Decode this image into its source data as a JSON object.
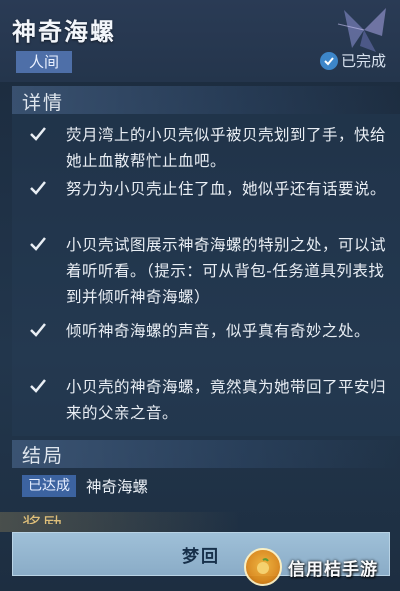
{
  "header": {
    "title": "神奇海螺",
    "realm_tag": "人间",
    "status": "已完成"
  },
  "details": {
    "section_title": "详情",
    "tasks": [
      {
        "text": "荧月湾上的小贝壳似乎被贝壳划到了手，快给她止血散帮忙止血吧。",
        "done": true
      },
      {
        "text": "努力为小贝壳止住了血，她似乎还有话要说。",
        "done": true
      },
      {
        "text": "小贝壳试图展示神奇海螺的特别之处，可以试着听听看。（提示：可从背包-任务道具列表找到并倾听神奇海螺）",
        "done": true
      },
      {
        "text": "倾听神奇海螺的声音，似乎真有奇妙之处。",
        "done": true
      },
      {
        "text": "小贝壳的神奇海螺，竟然真为她带回了平安归来的父亲之音。",
        "done": true
      }
    ]
  },
  "ending": {
    "section_title": "结局",
    "tag": "已达成",
    "name": "神奇海螺"
  },
  "reward": {
    "section_title": "奖励"
  },
  "actions": {
    "return_label": "梦回"
  },
  "watermark": {
    "text": "信用桔手游"
  },
  "colors": {
    "accent_blue": "#4e6fa8",
    "check_blue": "#3d86c9",
    "button_bg": "#9fc0d8"
  }
}
